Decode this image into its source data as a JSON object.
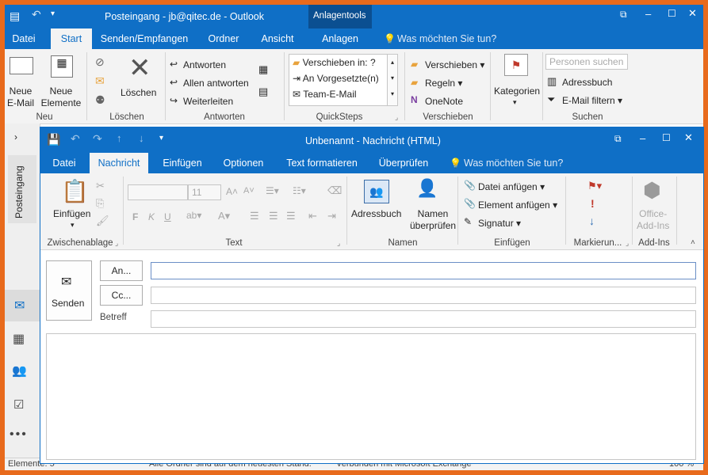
{
  "main_window": {
    "title": "Posteingang - jb@qitec.de - Outlook",
    "context_tab_group": "Anlagentools",
    "tabs": [
      "Datei",
      "Start",
      "Senden/Empfangen",
      "Ordner",
      "Ansicht",
      "Anlagen"
    ],
    "tell_me": "Was möchten Sie tun?",
    "ribbon": {
      "neu": {
        "label": "Neu",
        "new_email": "Neue\nE-Mail",
        "new_items": "Neue\nElemente"
      },
      "loeschen": {
        "label": "Löschen",
        "delete": "Löschen"
      },
      "antworten": {
        "label": "Antworten",
        "reply": "Antworten",
        "reply_all": "Allen antworten",
        "forward": "Weiterleiten"
      },
      "quicksteps": {
        "label": "QuickSteps",
        "items": [
          "Verschieben in: ?",
          "An Vorgesetzte(n)",
          "Team-E-Mail"
        ]
      },
      "verschieben": {
        "label": "Verschieben",
        "move": "Verschieben",
        "rules": "Regeln",
        "onenote": "OneNote"
      },
      "kategorien": {
        "label": "Kategorien"
      },
      "suchen": {
        "label": "Suchen",
        "search_people_placeholder": "Personen suchen",
        "address_book": "Adressbuch",
        "filter": "E-Mail filtern"
      }
    },
    "leftnav": {
      "folder_label": "Posteingang"
    },
    "status_left": "Elemente: 5",
    "status_mid1": "Alle Ordner sind auf dem neuesten Stand.",
    "status_mid2": "Verbunden mit Microsoft Exchange",
    "status_zoom": "100 %"
  },
  "message_window": {
    "title": "Unbenannt - Nachricht (HTML)",
    "tabs": [
      "Datei",
      "Nachricht",
      "Einfügen",
      "Optionen",
      "Text formatieren",
      "Überprüfen"
    ],
    "tell_me": "Was möchten Sie tun?",
    "ribbon": {
      "zwischenablage": {
        "label": "Zwischenablage",
        "paste": "Einfügen"
      },
      "text": {
        "label": "Text",
        "font_size": "11"
      },
      "namen": {
        "label": "Namen",
        "address_book": "Adressbuch",
        "check_names": "Namen\nüberprüfen"
      },
      "einfuegen": {
        "label": "Einfügen",
        "attach_file": "Datei anfügen",
        "attach_item": "Element anfügen",
        "signature": "Signatur"
      },
      "markierung": {
        "label": "Markierun..."
      },
      "addins": {
        "label": "Add-Ins",
        "office_addins": "Office-\nAdd-Ins"
      }
    },
    "send_button": "Senden",
    "to_button": "An...",
    "cc_button": "Cc...",
    "subject_label": "Betreff"
  },
  "colors": {
    "accent": "#0f6fc6",
    "frame": "#e86a1c",
    "context": "#0b4f91"
  }
}
